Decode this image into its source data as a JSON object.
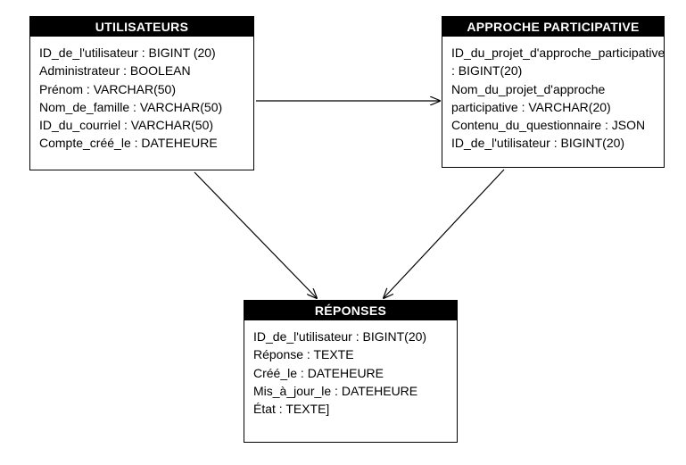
{
  "entities": {
    "users": {
      "title": "UTILISATEURS",
      "fields": [
        "ID_de_l'utilisateur : BIGINT (20)",
        "Administrateur : BOOLEAN",
        "Prénom : VARCHAR(50)",
        "Nom_de_famille : VARCHAR(50)",
        "ID_du_courriel : VARCHAR(50)",
        "Compte_créé_le : DATEHEURE"
      ]
    },
    "approach": {
      "title": "APPROCHE PARTICIPATIVE",
      "fields": [
        "ID_du_projet_d'approche_participative : BIGINT(20)",
        "Nom_du_projet_d'approche participative : VARCHAR(20)",
        "Contenu_du_questionnaire : JSON",
        "ID_de_l'utilisateur : BIGINT(20)"
      ]
    },
    "responses": {
      "title": "RÉPONSES",
      "fields": [
        "ID_de_l'utilisateur : BIGINT(20)",
        "Réponse : TEXTE",
        "Créé_le : DATEHEURE",
        "Mis_à_jour_le : DATEHEURE",
        "État : TEXTE]"
      ]
    }
  }
}
